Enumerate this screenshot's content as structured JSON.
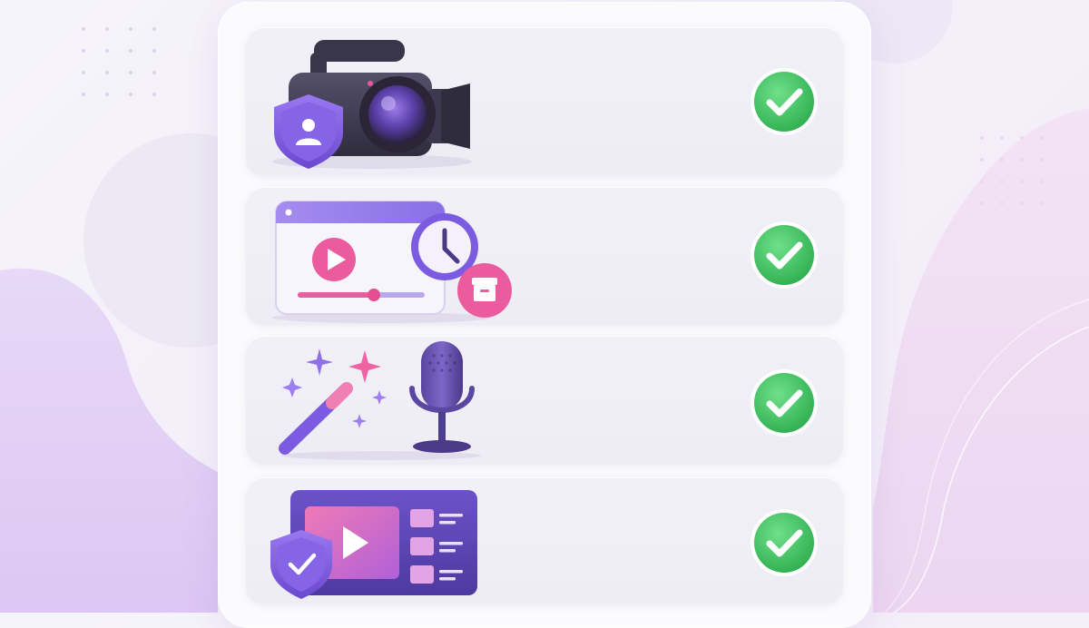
{
  "checklist": {
    "rows": [
      {
        "icon": "camcorder-with-privacy-shield-icon",
        "status": "complete",
        "status_icon": "green-checkmark-icon"
      },
      {
        "icon": "video-player-with-clock-and-archive-icon",
        "status": "complete",
        "status_icon": "green-checkmark-icon"
      },
      {
        "icon": "magic-wand-and-microphone-icon",
        "status": "complete",
        "status_icon": "green-checkmark-icon"
      },
      {
        "icon": "video-library-with-shield-icon",
        "status": "complete",
        "status_icon": "green-checkmark-icon"
      }
    ]
  },
  "colors": {
    "primary_purple": "#7b5ce0",
    "dark_purple": "#4b3a8a",
    "pink": "#e8589a",
    "check_green": "#3fbf5f",
    "card_bg": "#fbfafd",
    "row_bg": "#efedf5"
  }
}
